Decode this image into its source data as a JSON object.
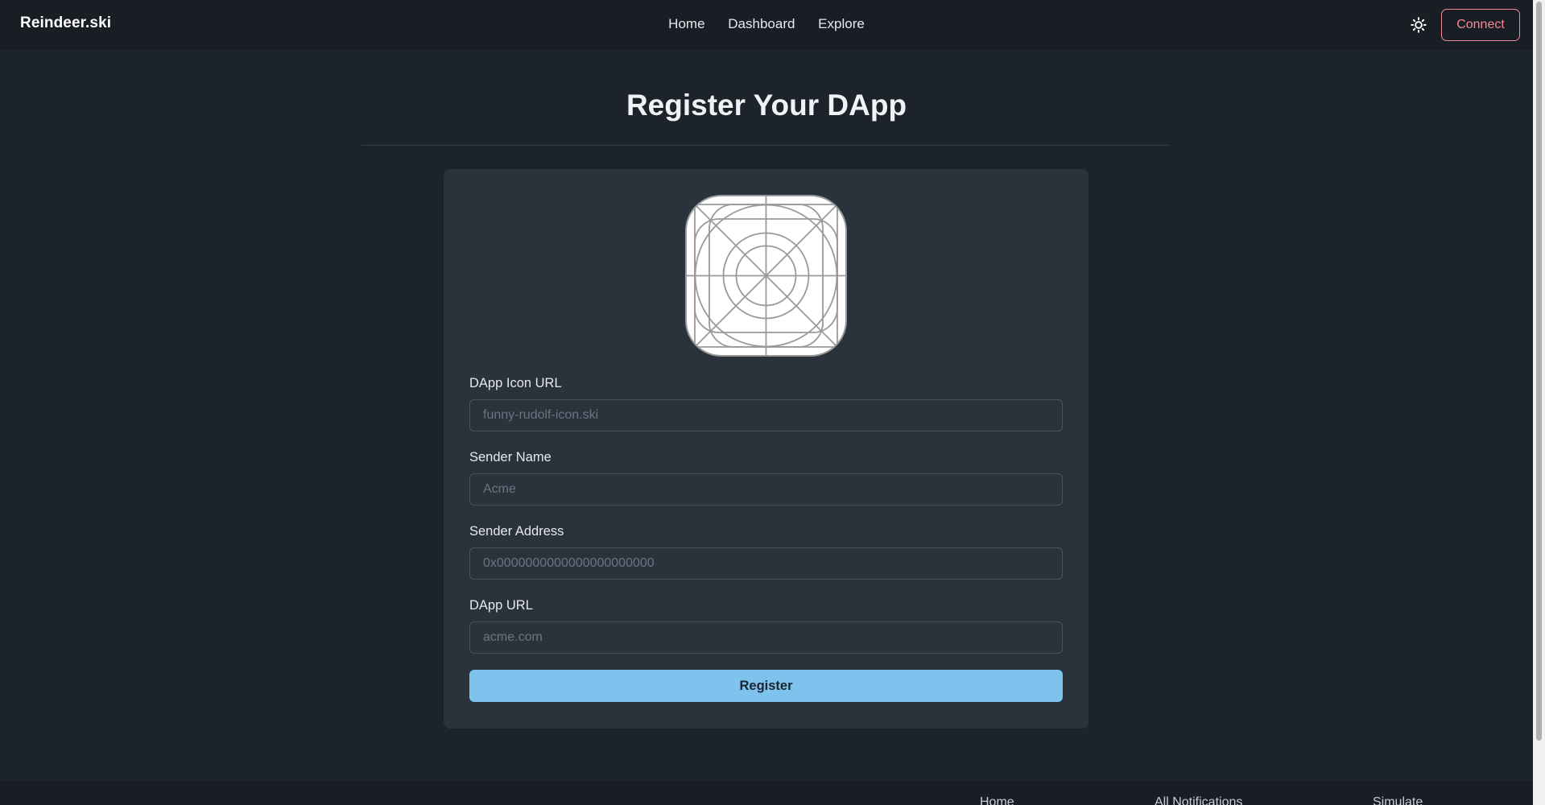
{
  "navbar": {
    "brand": "Reindeer.ski",
    "links": [
      "Home",
      "Dashboard",
      "Explore"
    ],
    "theme_icon": "sun-icon",
    "connect_label": "Connect"
  },
  "main": {
    "title": "Register Your DApp",
    "icon_preview": "app-icon-placeholder",
    "fields": [
      {
        "label": "DApp Icon URL",
        "placeholder": "funny-rudolf-icon.ski",
        "value": ""
      },
      {
        "label": "Sender Name",
        "placeholder": "Acme",
        "value": ""
      },
      {
        "label": "Sender Address",
        "placeholder": "0x0000000000000000000000",
        "value": ""
      },
      {
        "label": "DApp URL",
        "placeholder": "acme.com",
        "value": ""
      }
    ],
    "register_label": "Register"
  },
  "footer": {
    "links": [
      "Home",
      "All Notifications",
      "Simulate"
    ]
  },
  "colors": {
    "background": "#1d232a",
    "navbar": "#191e24",
    "card": "#2a323c",
    "accent_connect": "#f18a9a",
    "primary_button": "#7ec2ee"
  }
}
